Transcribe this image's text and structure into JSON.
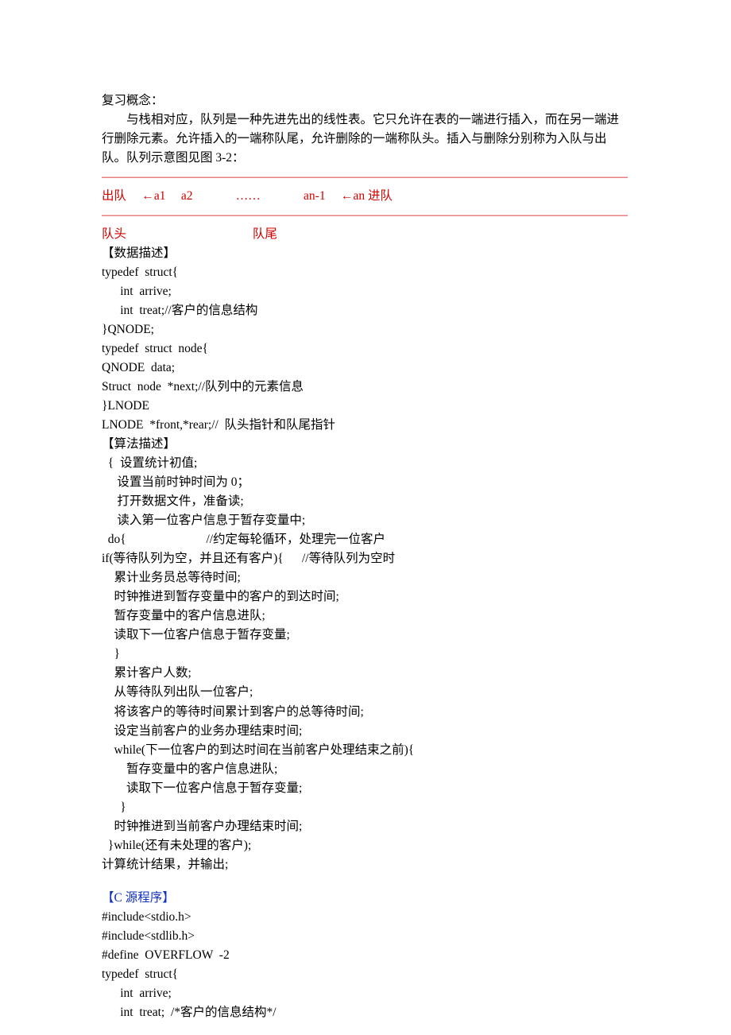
{
  "p1": "复习概念：",
  "p2": "与栈相对应，队列是一种先进先出的线性表。它只允许在表的一端进行插入，而在另一端进行删除元素。允许插入的一端称队尾，允许删除的一端称队头。插入与删除分别称为入队与出队。队列示意图见图 3-2：",
  "divider": "————————————————————————————————————————————",
  "queue": {
    "out": "出队",
    "a1": "←a1",
    "a2": "a2",
    "dots": "……",
    "an1": "an-1",
    "inarrow": "←an 进队"
  },
  "headlabel": "队头",
  "taillabel": "队尾",
  "h_data": "【数据描述】",
  "code1": [
    "typedef  struct{",
    "      int  arrive;",
    "      int  treat;//客户的信息结构",
    "}QNODE;",
    "typedef  struct  node{",
    "QNODE  data;",
    "Struct  node  *next;//队列中的元素信息",
    "}LNODE",
    "LNODE  *front,*rear;//  队头指针和队尾指针"
  ],
  "h_algo": "【算法描述】",
  "algo": [
    "  {  设置统计初值;",
    "     设置当前时钟时间为 0；",
    "     打开数据文件，准备读;",
    "     读入第一位客户信息于暂存变量中;",
    "  do{                          //约定每轮循环，处理完一位客户",
    "if(等待队列为空，并且还有客户){      //等待队列为空时",
    "    累计业务员总等待时间;",
    "    时钟推进到暂存变量中的客户的到达时间;",
    "    暂存变量中的客户信息进队;",
    "    读取下一位客户信息于暂存变量;",
    "    }",
    "    累计客户人数;",
    "    从等待队列出队一位客户;",
    "    将该客户的等待时间累计到客户的总等待时间;",
    "    设定当前客户的业务办理结束时间;",
    "    while(下一位客户的到达时间在当前客户处理结束之前){",
    "        暂存变量中的客户信息进队;",
    "        读取下一位客户信息于暂存变量;",
    "      }",
    "    时钟推进到当前客户办理结束时间;",
    "  }while(还有未处理的客户);",
    "计算统计结果，并输出;"
  ],
  "h_c": "【C 源程序】",
  "code2": [
    "#include<stdio.h>",
    "#include<stdlib.h>",
    "#define  OVERFLOW  -2",
    "typedef  struct{",
    "      int  arrive;",
    "      int  treat;  /*客户的信息结构*/"
  ]
}
